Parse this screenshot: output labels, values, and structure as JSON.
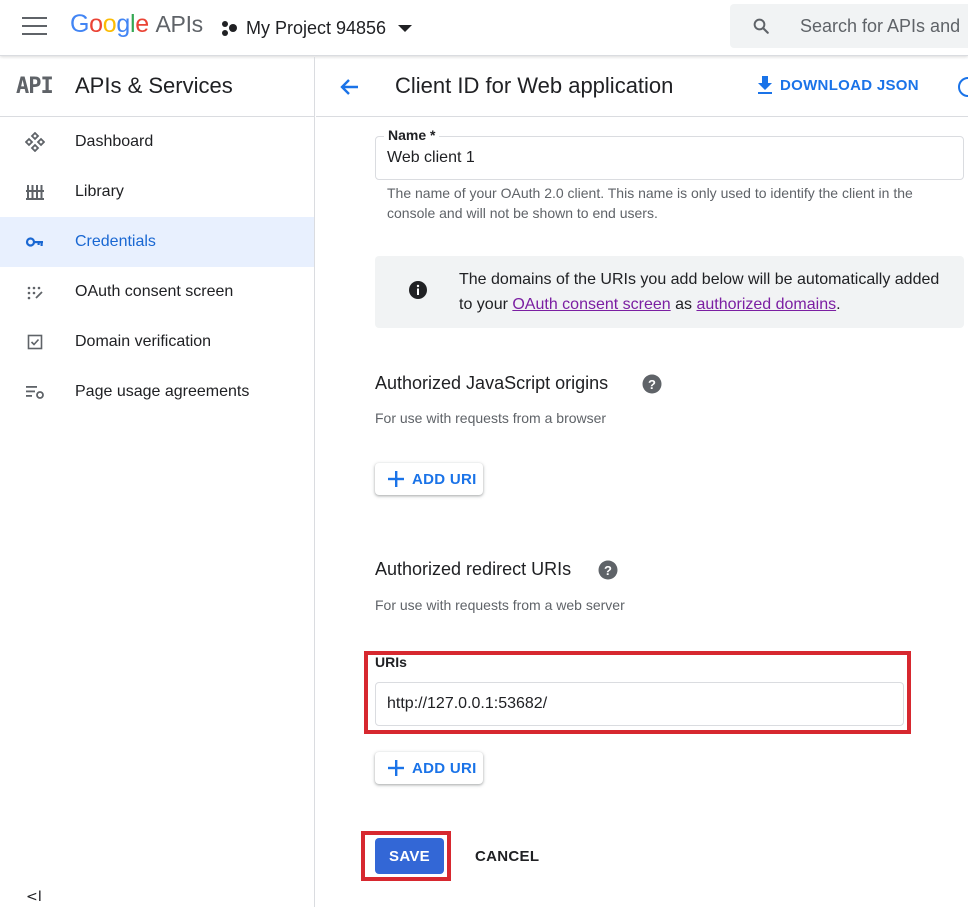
{
  "topbar": {
    "brand_letters": [
      "G",
      "o",
      "o",
      "g",
      "l",
      "e"
    ],
    "brand_suffix": "APIs",
    "project_name": "My Project 94856",
    "search_placeholder": "Search for APIs and"
  },
  "sidebar": {
    "logo": "API",
    "title": "APIs & Services",
    "items": [
      {
        "label": "Dashboard",
        "icon": "dashboard-icon"
      },
      {
        "label": "Library",
        "icon": "library-icon"
      },
      {
        "label": "Credentials",
        "icon": "key-icon",
        "active": true
      },
      {
        "label": "OAuth consent screen",
        "icon": "consent-icon"
      },
      {
        "label": "Domain verification",
        "icon": "checkbox-icon"
      },
      {
        "label": "Page usage agreements",
        "icon": "settings-list-icon"
      }
    ],
    "collapse_glyph": "<I"
  },
  "header": {
    "title": "Client ID for Web application",
    "download_label": "DOWNLOAD JSON"
  },
  "form": {
    "name_label": "Name *",
    "name_value": "Web client 1",
    "name_help": "The name of your OAuth 2.0 client. This name is only used to identify the client in the console and will not be shown to end users.",
    "info_prefix": "The domains of the URIs you add below will be automatically added to your ",
    "info_link1": "OAuth consent screen",
    "info_mid": " as ",
    "info_link2": "authorized domains",
    "info_suffix": ".",
    "js_origins_title": "Authorized JavaScript origins",
    "js_origins_sub": "For use with requests from a browser",
    "add_uri_label": "ADD URI",
    "redirect_title": "Authorized redirect URIs",
    "redirect_sub": "For use with requests from a web server",
    "uris_label": "URIs",
    "uri_value": "http://127.0.0.1:53682/",
    "save_label": "SAVE",
    "cancel_label": "CANCEL"
  },
  "colors": {
    "accent": "#1a73e8",
    "save_button": "#3367d6",
    "highlight_border": "#d7282f",
    "active_nav_bg": "#e8f0fe",
    "link_visited": "#7b1fa2"
  }
}
